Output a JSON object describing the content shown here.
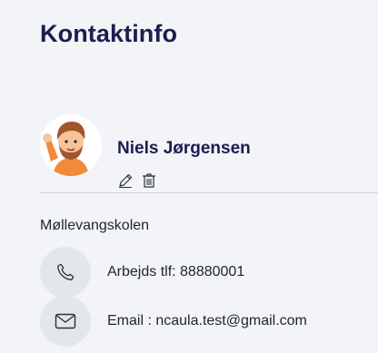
{
  "header": {
    "title": "Kontaktinfo"
  },
  "contact": {
    "name": "Niels Jørgensen",
    "organization": "Møllevangskolen",
    "phone_label": "Arbejds tlf: 88880001",
    "email_label": "Email : ncaula.test@gmail.com",
    "avatar_icon": "waving-person-avatar",
    "actions": {
      "edit_icon": "pencil-icon",
      "delete_icon": "trash-icon"
    }
  },
  "colors": {
    "background": "#f2f4f7",
    "title": "#1b1e4f",
    "icon_circle": "#e3e7ec",
    "avatar_shirt": "#f08a3c",
    "avatar_hair": "#a5552a"
  }
}
